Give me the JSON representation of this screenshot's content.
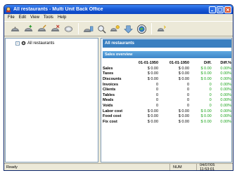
{
  "window": {
    "title": "All restaurants - Multi Unit Back Office"
  },
  "menu": [
    "File",
    "Edit",
    "View",
    "Tools",
    "Help"
  ],
  "toolbar": {
    "icons": [
      "restaurant-icon",
      "restaurant-add-icon",
      "restaurant-edit-icon",
      "restaurant-delete-icon",
      "group-icon",
      "group-edit-icon",
      "search-icon",
      "report-icon",
      "download-icon",
      "globe-icon",
      "help-icon"
    ]
  },
  "tree": {
    "root_label": "All restaurants",
    "expander": "-"
  },
  "main": {
    "header": "All restaurants",
    "section": "Sales overview",
    "columns": [
      "01-01-1950",
      "01-01-1950",
      "Diff.",
      "Diff.%"
    ],
    "rows": [
      {
        "label": "Sales",
        "a": "$ 0.00",
        "b": "$ 0.00",
        "diff": "$ 0.00",
        "pct": "0.00%"
      },
      {
        "label": "Taxes",
        "a": "$ 0.00",
        "b": "$ 0.00",
        "diff": "$ 0.00",
        "pct": "0.00%"
      },
      {
        "label": "Discounts",
        "a": "$ 0.00",
        "b": "$ 0.00",
        "diff": "$ 0.00",
        "pct": "0.00%"
      },
      {
        "label": "Invoices",
        "a": "0",
        "b": "0",
        "diff": "0",
        "pct": "0.00%"
      },
      {
        "label": "Clients",
        "a": "0",
        "b": "0",
        "diff": "0",
        "pct": "0.00%"
      },
      {
        "label": "Tables",
        "a": "0",
        "b": "0",
        "diff": "0",
        "pct": "0.00%"
      },
      {
        "label": "Meals",
        "a": "0",
        "b": "0",
        "diff": "0",
        "pct": "0.00%"
      },
      {
        "label": "Voids",
        "a": "0",
        "b": "0",
        "diff": "0",
        "pct": "0.00%"
      },
      {
        "label": "Labor cost",
        "a": "$ 0.00",
        "b": "$ 0.00",
        "diff": "$ 0.00",
        "pct": "0.00%"
      },
      {
        "label": "Food cost",
        "a": "$ 0.00",
        "b": "$ 0.00",
        "diff": "$ 0.00",
        "pct": "0.00%"
      },
      {
        "label": "Fix cost",
        "a": "$ 0.00",
        "b": "$ 0.00",
        "diff": "$ 0.00",
        "pct": "0.00%"
      }
    ]
  },
  "status": {
    "text": "Ready",
    "num": "NUM",
    "datetime": "04/07/05 11:53:01"
  },
  "colors": {
    "titlebar": "#1a5ad6",
    "header": "#3a7fc0",
    "diff_green": "#1aa31a"
  }
}
